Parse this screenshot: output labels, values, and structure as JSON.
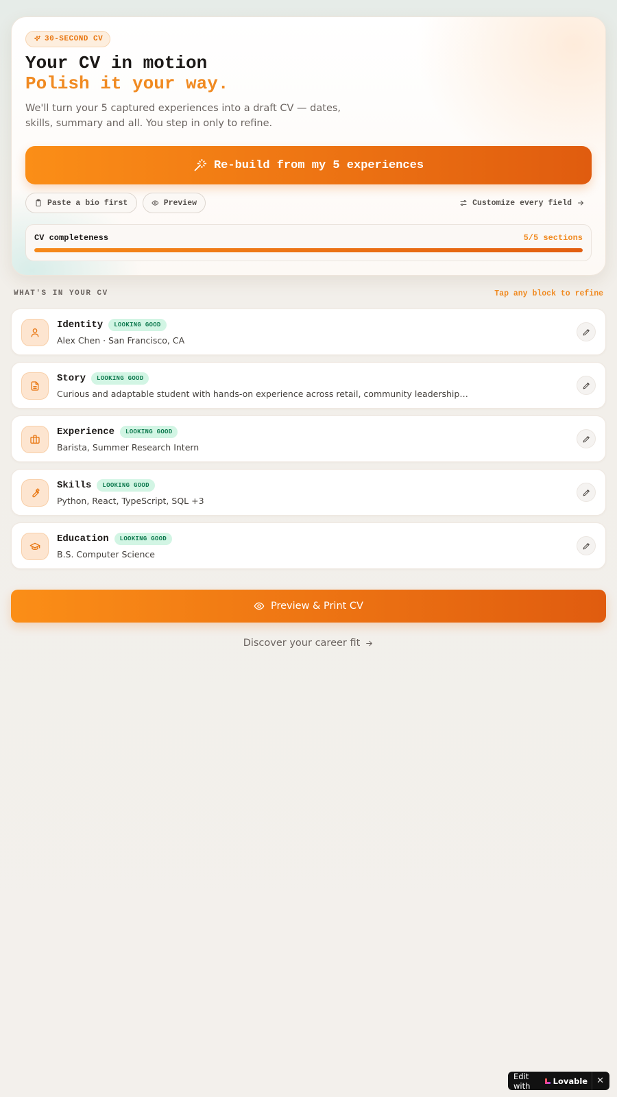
{
  "hero": {
    "badge": "30-SECOND CV",
    "title": "Your CV in motion",
    "subtitle": "Polish it your way.",
    "description": "We'll turn your 5 captured experiences into a draft CV — dates, skills, summary and all. You step in only to refine.",
    "primary_button": "Re-build from my 5 experiences",
    "chip_bio": "Paste a bio first",
    "chip_preview": "Preview",
    "customize_link": "Customize every field",
    "progress": {
      "label": "CV completeness",
      "value_text": "5/5 sections",
      "fraction": 1.0
    }
  },
  "section": {
    "heading": "WHAT'S IN YOUR CV",
    "hint": "Tap any block to refine"
  },
  "cards": [
    {
      "title": "Identity",
      "status": "LOOKING GOOD",
      "subtitle": "Alex Chen · San Francisco, CA",
      "icon": "user-icon"
    },
    {
      "title": "Story",
      "status": "LOOKING GOOD",
      "subtitle": "Curious and adaptable student with hands-on experience across retail, community leadership…",
      "icon": "document-icon"
    },
    {
      "title": "Experience",
      "status": "LOOKING GOOD",
      "subtitle": "Barista, Summer Research Intern",
      "icon": "briefcase-icon"
    },
    {
      "title": "Skills",
      "status": "LOOKING GOOD",
      "subtitle": "Python, React, TypeScript, SQL +3",
      "icon": "wrench-icon"
    },
    {
      "title": "Education",
      "status": "LOOKING GOOD",
      "subtitle": "B.S. Computer Science",
      "icon": "graduation-cap-icon"
    }
  ],
  "actions": {
    "print_button": "Preview & Print CV",
    "career_link": "Discover your career fit"
  },
  "lovable": {
    "prefix": "Edit with",
    "brand": "Lovable"
  },
  "colors": {
    "accent": "#f08a21",
    "accent_dark": "#e05c0f",
    "status_bg": "#d2f5e4",
    "status_text": "#0f7a4f"
  }
}
